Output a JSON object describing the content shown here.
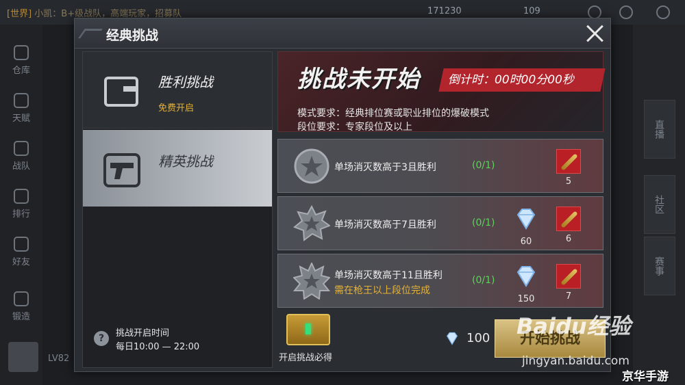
{
  "background": {
    "chat_channel": "[世界]",
    "chat_text": "小凯：B+级战队，高端玩家，招募队",
    "resource_1": "171230",
    "resource_2": "109",
    "left_nav": [
      "仓库",
      "天赋",
      "战队",
      "排行",
      "好友",
      "锻造"
    ],
    "right_tabs": [
      "直播",
      "社区",
      "赛事"
    ],
    "level": "LV82"
  },
  "dialog": {
    "title": "经典挑战",
    "tabs": [
      {
        "label": "胜利挑战",
        "sub": "免费开启"
      },
      {
        "label": "精英挑战",
        "sub": ""
      }
    ],
    "schedule_label": "挑战开启时间",
    "schedule_time": "每日10:00 — 22:00",
    "status_title": "挑战未开始",
    "countdown": "倒计时：00时00分00秒",
    "mode_requirement": "模式要求：经典排位赛或职业排位的爆破模式",
    "rank_requirement": "段位要求：专家段位及以上",
    "tasks": [
      {
        "text": "单场消灭数高于3且胜利",
        "note": "",
        "progress": "(0/1)",
        "rewards": [
          {
            "icon": "ammo-crate",
            "count": "5"
          }
        ]
      },
      {
        "text": "单场消灭数高于7且胜利",
        "note": "",
        "progress": "(0/1)",
        "rewards": [
          {
            "icon": "diamond",
            "count": "60"
          },
          {
            "icon": "ammo-crate",
            "count": "6"
          }
        ]
      },
      {
        "text": "单场消灭数高于11且胜利",
        "note": "需在枪王以上段位完成",
        "progress": "(0/1)",
        "rewards": [
          {
            "icon": "diamond",
            "count": "150"
          },
          {
            "icon": "ammo-crate",
            "count": "7"
          }
        ]
      }
    ],
    "chest_label": "开启挑战必得",
    "cost": "100",
    "start_button": "开始挑战"
  },
  "watermark": {
    "brand": "Baidu经验",
    "url": "jingyan.baidu.com",
    "corner": "京华手游"
  },
  "colors": {
    "accent_red": "#b2252d",
    "gold": "#e4b23a",
    "progress_green": "#5ed35e"
  }
}
